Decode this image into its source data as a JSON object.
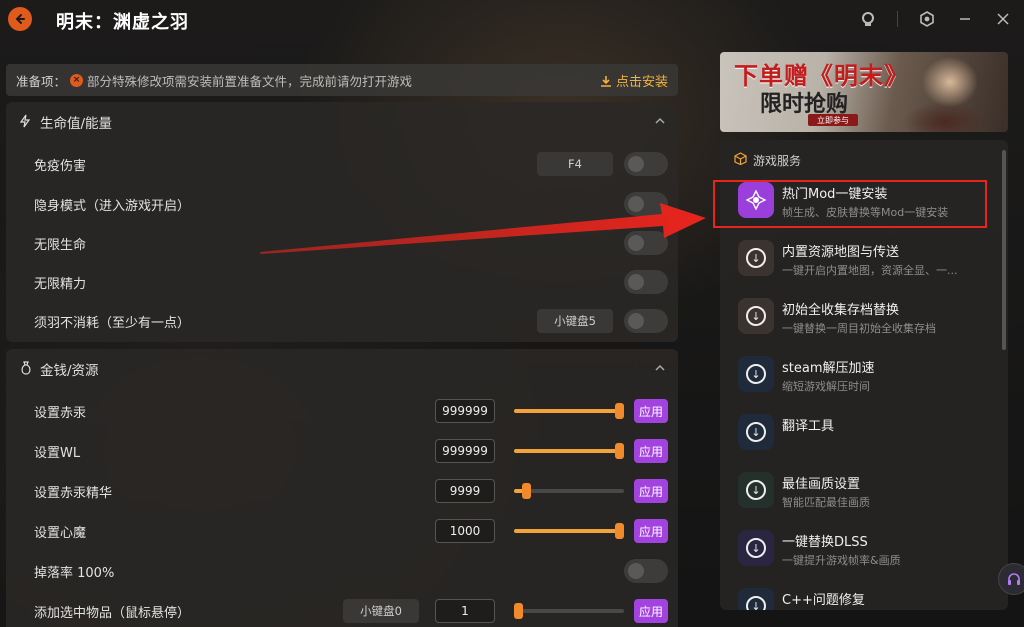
{
  "window": {
    "title": "明末：渊虚之羽"
  },
  "prep": {
    "label": "准备项：",
    "text": "部分特殊修改项需安装前置准备文件，完成前请勿打开游戏",
    "install_label": "点击安装"
  },
  "health_section": {
    "title": "生命值/能量",
    "rows": [
      {
        "label": "免疫伤害",
        "hotkey": "F4",
        "enabled": false
      },
      {
        "label": "隐身模式（进入游戏开启）",
        "hotkey": "",
        "enabled": false
      },
      {
        "label": "无限生命",
        "hotkey": "",
        "enabled": false
      },
      {
        "label": "无限精力",
        "hotkey": "",
        "enabled": false
      },
      {
        "label": "须羽不消耗（至少有一点）",
        "hotkey": "小键盘5",
        "enabled": false
      }
    ]
  },
  "money_section": {
    "title": "金钱/资源",
    "apply_label": "应用",
    "rows": [
      {
        "label": "设置赤汞",
        "value": "999999",
        "slider_fraction": 1.0
      },
      {
        "label": "设置WL",
        "value": "999999",
        "slider_fraction": 1.0
      },
      {
        "label": "设置赤汞精华",
        "value": "9999",
        "slider_fraction": 0.08
      },
      {
        "label": "设置心魔",
        "value": "1000",
        "slider_fraction": 1.0
      }
    ],
    "drop_rate": {
      "label": "掉落率 100%",
      "enabled": false
    },
    "add_item": {
      "label": "添加选中物品（鼠标悬停）",
      "hotkey": "小键盘0",
      "value": "1",
      "slider_fraction": 0.0
    }
  },
  "banner": {
    "title": "下单赠《明末》",
    "subtitle": "限时抢购",
    "cta": "立即参与"
  },
  "services": {
    "title": "游戏服务",
    "items": [
      {
        "title": "热门Mod一键安装",
        "desc": "帧生成、皮肤替换等Mod一键安装",
        "icon": "mod-icon"
      },
      {
        "title": "内置资源地图与传送",
        "desc": "一键开启内置地图，资源全显、一...",
        "icon": "download-icon"
      },
      {
        "title": "初始全收集存档替换",
        "desc": "一键替换一周目初始全收集存档",
        "icon": "download-icon"
      },
      {
        "title": "steam解压加速",
        "desc": "缩短游戏解压时间",
        "icon": "download-icon"
      },
      {
        "title": "翻译工具",
        "desc": "",
        "icon": "download-icon"
      },
      {
        "title": "最佳画质设置",
        "desc": "智能匹配最佳画质",
        "icon": "download-icon"
      },
      {
        "title": "一键替换DLSS",
        "desc": "一键提升游戏帧率&画质",
        "icon": "download-icon"
      },
      {
        "title": "C++问题修复",
        "desc": "",
        "icon": "download-icon"
      }
    ]
  },
  "colors": {
    "accent_orange": "#f2a33a",
    "apply_purple": "#a243e0",
    "highlight_red": "#e8251d"
  }
}
